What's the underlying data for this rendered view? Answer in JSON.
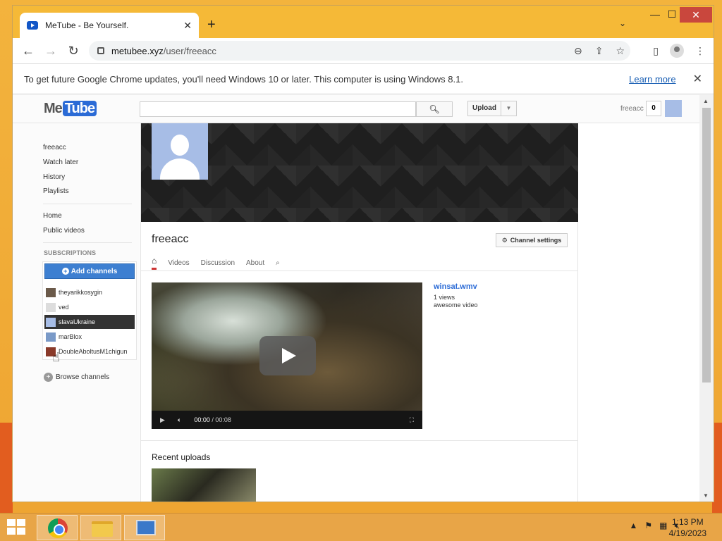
{
  "browser": {
    "tab_title": "MeTube - Be Yourself.",
    "url_domain": "metubee.xyz",
    "url_path": "/user/freeacc",
    "infobar_message": "To get future Google Chrome updates, you'll need Windows 10 or later. This computer is using Windows 8.1.",
    "infobar_link": "Learn more"
  },
  "header": {
    "logo_me": "Me",
    "logo_tube": "Tube",
    "search_placeholder": "",
    "upload_label": "Upload",
    "username": "freeacc",
    "notif_count": "0"
  },
  "sidebar": {
    "top_items": [
      "freeacc",
      "Watch later",
      "History",
      "Playlists"
    ],
    "mid_items": [
      "Home",
      "Public videos"
    ],
    "subscriptions_heading": "SUBSCRIPTIONS",
    "add_channels_label": "Add channels",
    "subscriptions": [
      "theyarikkosygin",
      "ved",
      "slavaUkraine",
      "marBlox",
      "DoubleAboltusM1chigun"
    ],
    "active_subscription": "slavaUkraine",
    "browse_label": "Browse channels"
  },
  "channel": {
    "name": "freeacc",
    "settings_label": "Channel settings",
    "tabs": [
      "Videos",
      "Discussion",
      "About"
    ],
    "video": {
      "title": "winsat.wmv",
      "views": "1 views",
      "description": "awesome video",
      "time_current": "00:00",
      "time_total": "00:08"
    },
    "recent_heading": "Recent uploads"
  },
  "taskbar": {
    "time": "1:13 PM",
    "date": "4/19/2023"
  },
  "colors": {
    "accent_blue": "#2b6bd6",
    "titlebar": "#f5b937",
    "active_sub_bg": "#333333"
  }
}
